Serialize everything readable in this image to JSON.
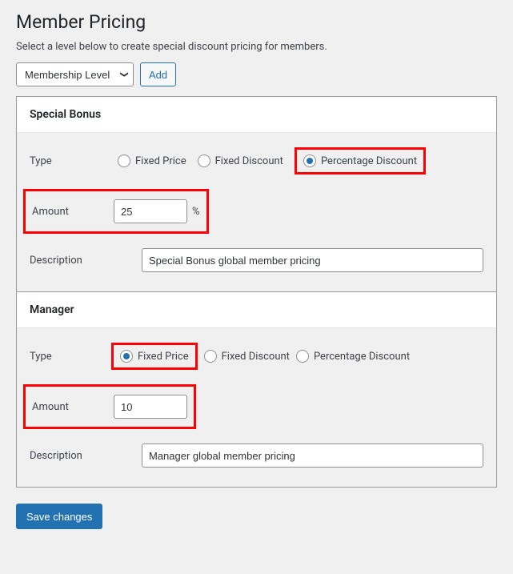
{
  "page": {
    "title": "Member Pricing",
    "subtitle": "Select a level below to create special discount pricing for members."
  },
  "top": {
    "level_select": "Membership Level",
    "add_button": "Add"
  },
  "sections": [
    {
      "title": "Special Bonus",
      "type_label": "Type",
      "type_options": {
        "fixed_price": "Fixed Price",
        "fixed_discount": "Fixed Discount",
        "percentage_discount": "Percentage Discount"
      },
      "selected_type": "percentage_discount",
      "amount_label": "Amount",
      "amount_value": "25",
      "amount_suffix": "%",
      "description_label": "Description",
      "description_value": "Special Bonus global member pricing"
    },
    {
      "title": "Manager",
      "type_label": "Type",
      "type_options": {
        "fixed_price": "Fixed Price",
        "fixed_discount": "Fixed Discount",
        "percentage_discount": "Percentage Discount"
      },
      "selected_type": "fixed_price",
      "amount_label": "Amount",
      "amount_value": "10",
      "amount_suffix": "",
      "description_label": "Description",
      "description_value": "Manager global member pricing"
    }
  ],
  "save_button": "Save changes"
}
